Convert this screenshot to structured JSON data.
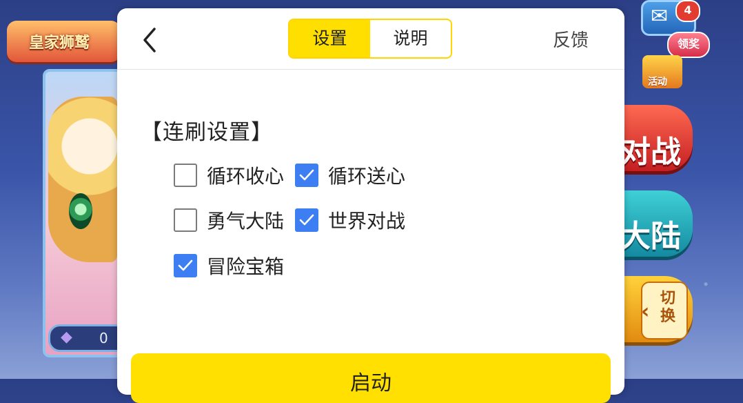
{
  "background": {
    "game_title": "皇家狮鹫",
    "gem_count": "0",
    "mail_badge": "4",
    "reward_label": "领奖",
    "event_label": "活动",
    "battle_label": "对战",
    "continent_label": "大陆",
    "switch_label": "切换"
  },
  "header": {
    "tabs": [
      {
        "label": "设置",
        "active": true
      },
      {
        "label": "说明",
        "active": false
      }
    ],
    "feedback_label": "反馈"
  },
  "settings": {
    "section_title": "【连刷设置】",
    "options": [
      {
        "label": "循环收心",
        "checked": false
      },
      {
        "label": "循环送心",
        "checked": true
      },
      {
        "label": "勇气大陆",
        "checked": false
      },
      {
        "label": "世界对战",
        "checked": true
      },
      {
        "label": "冒险宝箱",
        "checked": true
      }
    ]
  },
  "footer": {
    "start_label": "启动"
  },
  "colors": {
    "accent_yellow": "#ffdf00",
    "checkbox_blue": "#3d7ff3"
  }
}
